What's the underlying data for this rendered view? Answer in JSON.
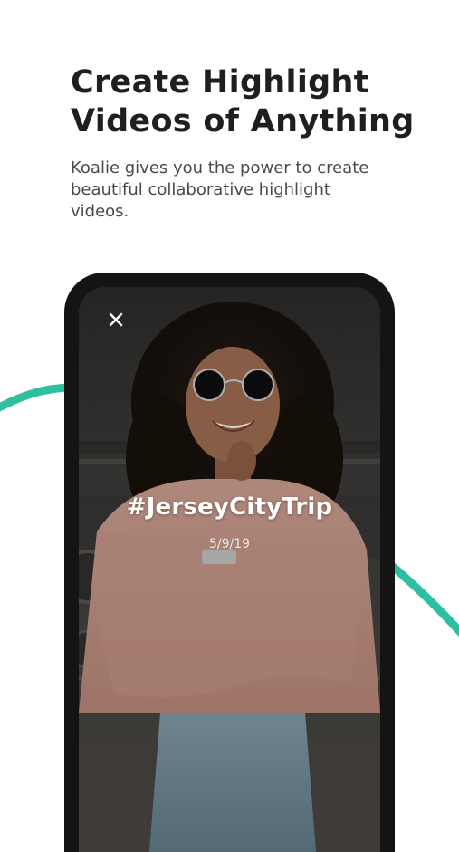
{
  "headline": {
    "line1": "Create Highlight",
    "line2": "Videos of Anything"
  },
  "subtitle": {
    "line1": "Koalie gives you the power to create",
    "line2": "beautiful collaborative highlight",
    "line3": "videos."
  },
  "phone_screen": {
    "close_icon": "close-icon",
    "title": "#JerseyCityTrip",
    "date": "5/9/19"
  },
  "colors": {
    "accent": "#2dbfa0",
    "headline": "#1f1f1f",
    "subtitle": "#4a4a4a",
    "phone_frame": "#141414"
  }
}
